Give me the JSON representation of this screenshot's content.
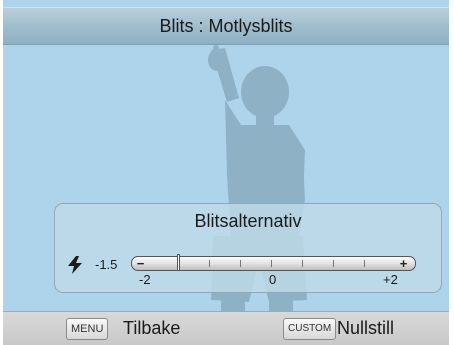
{
  "title": "Blits : Motlysblits",
  "panel": {
    "title": "Blitsalternativ",
    "current_value": "-1.5",
    "value": -1.5,
    "min": -2,
    "max": 2,
    "step": 0.5,
    "scale_labels": [
      "-2",
      "0",
      "+2"
    ],
    "minus_symbol": "−",
    "plus_symbol": "+",
    "icon": "flash-icon"
  },
  "footer": {
    "back_key": "MENU",
    "back_label": "Tilbake",
    "reset_key": "CUSTOM",
    "reset_label": "Nullstill"
  },
  "colors": {
    "background": "#aed4ec",
    "silhouette": "#8fb1c5"
  }
}
